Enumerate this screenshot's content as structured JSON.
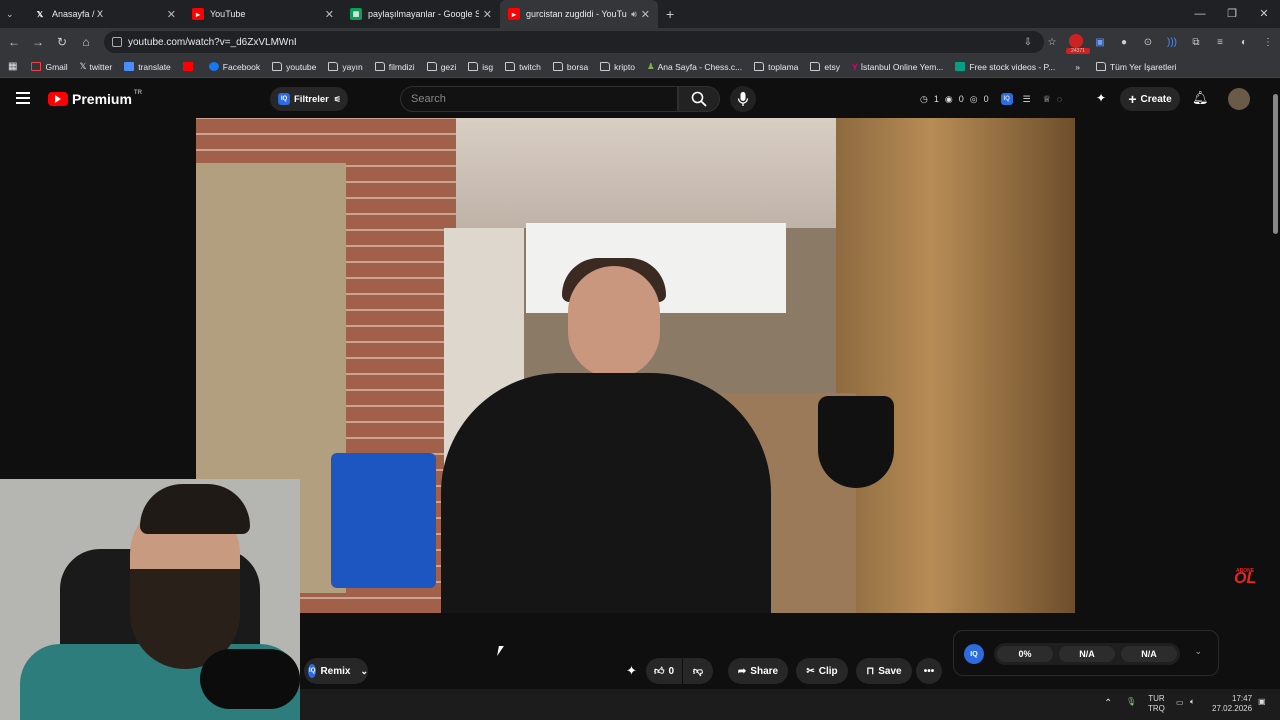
{
  "browser": {
    "tabs": [
      {
        "title": "Anasayfa / X",
        "favicon": "x-logo-icon"
      },
      {
        "title": "YouTube",
        "favicon": "youtube-icon"
      },
      {
        "title": "paylaşılmayanlar - Google Shee",
        "favicon": "sheets-icon"
      },
      {
        "title": "gurcistan zugdidi - YouTub",
        "favicon": "youtube-icon",
        "active": true
      }
    ],
    "url": "youtube.com/watch?v=_d6ZxVLMWnI",
    "ext_badge": "24371",
    "bookmarks": [
      {
        "label": "Gmail",
        "icon": "gmail-icon"
      },
      {
        "label": "twitter",
        "icon": "x-logo-icon"
      },
      {
        "label": "translate",
        "icon": "translate-icon"
      },
      {
        "label": "",
        "icon": "youtube-icon"
      },
      {
        "label": "Facebook",
        "icon": "facebook-icon"
      },
      {
        "label": "youtube",
        "icon": "folder-icon"
      },
      {
        "label": "yayın",
        "icon": "folder-icon"
      },
      {
        "label": "filmdizi",
        "icon": "folder-icon"
      },
      {
        "label": "gezi",
        "icon": "folder-icon"
      },
      {
        "label": "isg",
        "icon": "folder-icon"
      },
      {
        "label": "twitch",
        "icon": "folder-icon"
      },
      {
        "label": "borsa",
        "icon": "folder-icon"
      },
      {
        "label": "kripto",
        "icon": "folder-icon"
      },
      {
        "label": "Ana Sayfa - Chess.c...",
        "icon": "chess-icon"
      },
      {
        "label": "toplama",
        "icon": "folder-icon"
      },
      {
        "label": "etsy",
        "icon": "folder-icon"
      },
      {
        "label": "İstanbul Online Yem...",
        "icon": "yemeksepeti-icon"
      },
      {
        "label": "Free stock videos - P...",
        "icon": "pexels-icon"
      }
    ],
    "all_bookmarks": "Tüm Yer İşaretleri"
  },
  "youtube": {
    "logo": "Premium",
    "region": "TR",
    "filter_label": "Filtreler",
    "search_placeholder": "Search",
    "stats": [
      "1",
      "0",
      "0"
    ],
    "create_label": "Create"
  },
  "video": {
    "overlay_logo_small": "ABONE",
    "overlay_logo": "OL"
  },
  "actions": {
    "remix": "Remix",
    "likes": "0",
    "share": "Share",
    "clip": "Clip",
    "save": "Save"
  },
  "iq_panel": {
    "badge": "IQ",
    "values": [
      "0%",
      "N/A",
      "N/A"
    ]
  },
  "taskbar": {
    "lang_top": "TUR",
    "lang_bottom": "TRQ",
    "time": "17:47",
    "date": "27.02.2026"
  },
  "colors": {
    "accent": "#2d6be0",
    "youtube_red": "#ff0000",
    "sheets_green": "#0f9d58"
  }
}
